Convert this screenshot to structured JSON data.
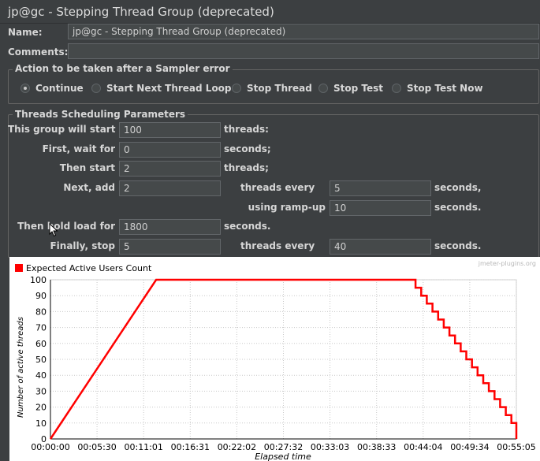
{
  "window": {
    "title": "jp@gc - Stepping Thread Group (deprecated)"
  },
  "form": {
    "name_label": "Name:",
    "name_value": "jp@gc - Stepping Thread Group (deprecated)",
    "comments_label": "Comments:",
    "comments_value": ""
  },
  "error_action": {
    "title": "Action to be taken after a Sampler error",
    "options": [
      {
        "label": "Continue",
        "selected": true
      },
      {
        "label": "Start Next Thread Loop",
        "selected": false
      },
      {
        "label": "Stop Thread",
        "selected": false
      },
      {
        "label": "Stop Test",
        "selected": false
      },
      {
        "label": "Stop Test Now",
        "selected": false
      }
    ]
  },
  "schedule": {
    "title": "Threads Scheduling Parameters",
    "start_label": "This group will start",
    "start_value": "100",
    "start_unit": "threads:",
    "wait_label": "First, wait for",
    "wait_value": "0",
    "wait_unit": "seconds;",
    "then_start_label": "Then start",
    "then_start_value": "2",
    "then_start_unit": "threads;",
    "next_add_label": "Next, add",
    "next_add_value": "2",
    "every_label": "threads every",
    "every_value": "5",
    "every_unit": "seconds,",
    "rampup_label": "using ramp-up",
    "rampup_value": "10",
    "rampup_unit": "seconds.",
    "hold_label": "Then hold load for",
    "hold_value": "1800",
    "hold_unit": "seconds.",
    "stop_label": "Finally, stop",
    "stop_value": "5",
    "stop_every_label": "threads every",
    "stop_every_value": "40",
    "stop_every_unit": "seconds."
  },
  "chart_data": {
    "type": "line",
    "watermark": "jmeter-plugins.org",
    "legend": "Expected Active Users Count",
    "ylabel": "Number of active threads",
    "xlabel": "Elapsed time",
    "series_color": "#ff0000",
    "ylim": [
      0,
      100
    ],
    "yticks": [
      "0",
      "10",
      "20",
      "30",
      "40",
      "50",
      "60",
      "70",
      "80",
      "90",
      "100"
    ],
    "xticks": [
      "00:00:00",
      "00:05:30",
      "00:11:01",
      "00:16:31",
      "00:22:02",
      "00:27:32",
      "00:33:03",
      "00:38:33",
      "00:44:04",
      "00:49:34",
      "00:55:05"
    ],
    "x_seconds": [
      0,
      750,
      2550,
      2590,
      2630,
      2670,
      2710,
      2750,
      2790,
      2830,
      2870,
      2910,
      2950,
      2990,
      3030,
      3070,
      3110,
      3150,
      3190,
      3230,
      3270,
      3305
    ],
    "y": [
      0,
      100,
      100,
      95,
      90,
      85,
      80,
      75,
      70,
      65,
      60,
      55,
      50,
      45,
      40,
      35,
      30,
      25,
      20,
      15,
      10,
      5
    ]
  }
}
